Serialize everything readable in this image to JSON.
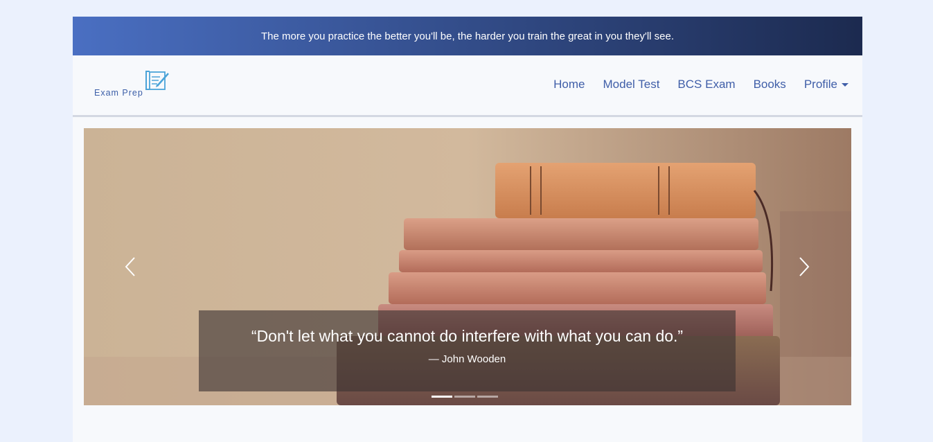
{
  "banner": {
    "text": "The more you practice the better you'll be, the harder you train the great in you they'll see."
  },
  "logo": {
    "text": "Exam Prep",
    "icon": "notepad-pen-icon"
  },
  "nav": {
    "items": [
      {
        "label": "Home"
      },
      {
        "label": "Model Test"
      },
      {
        "label": "BCS Exam"
      },
      {
        "label": "Books"
      },
      {
        "label": "Profile"
      }
    ]
  },
  "carousel": {
    "caption": {
      "quote": "“Don't let what you cannot do interfere with what you can do.”",
      "author": "— John Wooden"
    },
    "slide_count": 3,
    "active_index": 0,
    "prev_icon": "chevron-left-icon",
    "next_icon": "chevron-right-icon"
  },
  "colors": {
    "page_background": "#ebf1fd",
    "banner_gradient_start": "#4a6fc2",
    "banner_gradient_end": "#1c2a4f",
    "nav_link": "#3f5ea8",
    "logo_accent": "#4aa3d8"
  }
}
